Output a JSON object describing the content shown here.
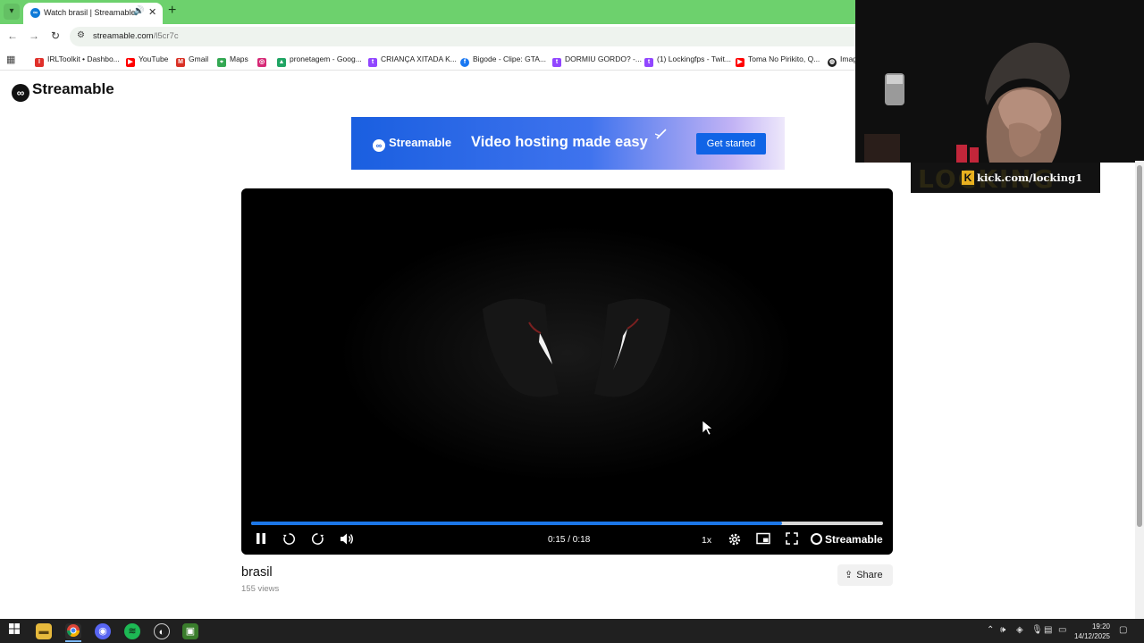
{
  "browser": {
    "tab": {
      "title": "Watch brasil | Streamable",
      "audio_icon": "speaker-icon",
      "close": "✕"
    },
    "newtab": "+",
    "url_host": "streamable.com",
    "url_path": "/l5cr7c",
    "bookmarks": [
      {
        "label": "IRLToolkit • Dashbo...",
        "color": "#e0302a",
        "icon": "irltoolkit-icon"
      },
      {
        "label": "YouTube",
        "color": "#ff0000",
        "icon": "youtube-icon"
      },
      {
        "label": "Gmail",
        "color": "#d93025",
        "icon": "gmail-icon"
      },
      {
        "label": "Maps",
        "color": "#34a853",
        "icon": "maps-icon"
      },
      {
        "label": "",
        "color": "#d62976",
        "icon": "instagram-icon"
      },
      {
        "label": "pronetagem - Goog...",
        "color": "#1fa463",
        "icon": "google-drive-icon"
      },
      {
        "label": "CRIANÇA XITADA K...",
        "color": "#9146ff",
        "icon": "twitch-icon"
      },
      {
        "label": "Bigode - Clipe: GTA...",
        "color": "#1877f2",
        "icon": "facebook-icon"
      },
      {
        "label": "DORMIU GORDO? -...",
        "color": "#9146ff",
        "icon": "twitch-icon"
      },
      {
        "label": "(1) Lockingfps - Twit...",
        "color": "#9146ff",
        "icon": "twitch-icon"
      },
      {
        "label": "Toma No Pirikito, Q...",
        "color": "#ff0000",
        "icon": "youtube-icon"
      },
      {
        "label": "Imag",
        "color": "#222222",
        "icon": "globe-icon"
      }
    ]
  },
  "page": {
    "logo": "Streamable",
    "ad": {
      "brand": "Streamable",
      "tagline": "Video hosting made easy",
      "cta": "Get started"
    },
    "player": {
      "time": "0:15 / 0:18",
      "progress": 0.84,
      "speed": "1x",
      "brand": "Streamable"
    },
    "video_title": "brasil",
    "views": "155 views",
    "share": "Share"
  },
  "overlay": {
    "kick_bg": "LOCKING",
    "kick_label": "kick.com/locking1"
  },
  "taskbar": {
    "time": "19:20",
    "date": "14/12/2025"
  },
  "colors": {
    "tabbar": "#6dd16d",
    "accent": "#1c77e8",
    "ad_cta": "#1064e6",
    "kick": "#e8b020"
  }
}
